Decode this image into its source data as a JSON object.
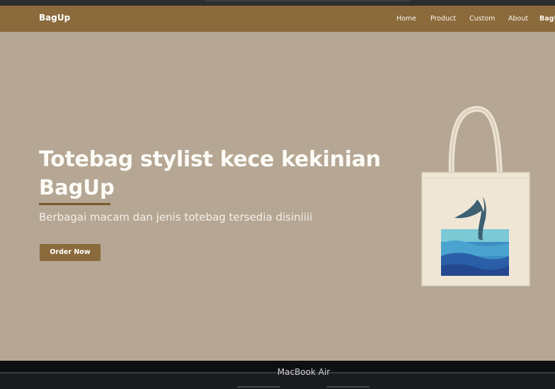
{
  "brand": "BagUp",
  "nav": {
    "home": "Home",
    "product": "Product",
    "custom": "Custom",
    "about": "About",
    "cut": "BagU"
  },
  "hero": {
    "title": "Totebag stylist kece kekinian",
    "brand": "BagUp",
    "subtitle": "Berbagai macam dan jenis totebag tersedia disiniiii",
    "cta": "Order Now"
  },
  "device": {
    "label": "MacBook Air"
  },
  "colors": {
    "navbar": "#8b6a3b",
    "background": "#b5a794",
    "accent": "#7a5a2d"
  },
  "icons": {
    "hero_image": "totebag-whale-tail-illustration"
  }
}
